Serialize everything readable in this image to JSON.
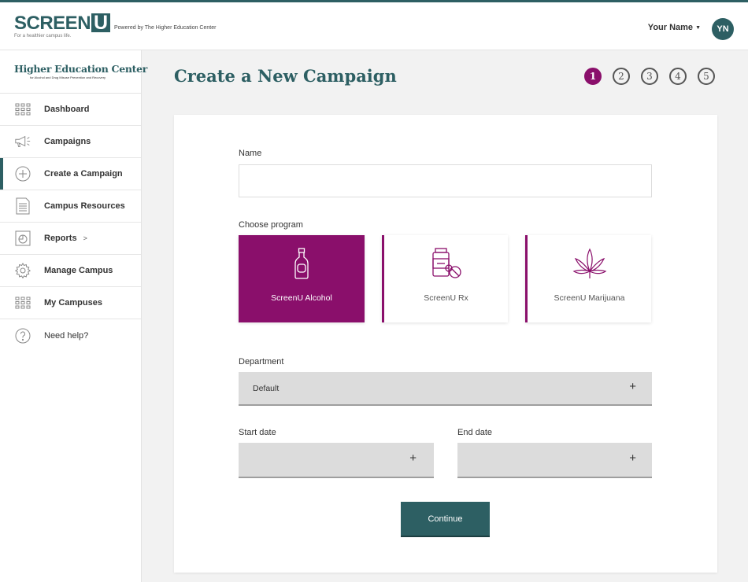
{
  "header": {
    "logo_text": "SCREEN",
    "logo_u": "U",
    "logo_tagline": "For a healthier campus life.",
    "powered_by": "Powered by The Higher Education Center",
    "user_name": "Your Name",
    "user_initials": "YN"
  },
  "sidebar": {
    "org_title": "Higher Education Center",
    "org_subtitle": "for Alcohol and Drug Misuse Prevention and Recovery",
    "items": [
      {
        "label": "Dashboard",
        "icon": "grid-icon"
      },
      {
        "label": "Campaigns",
        "icon": "megaphone-icon"
      },
      {
        "label": "Create a Campaign",
        "icon": "plus-circle-icon",
        "active": true
      },
      {
        "label": "Campus Resources",
        "icon": "document-icon"
      },
      {
        "label": "Reports",
        "icon": "report-icon",
        "chevron": ">"
      },
      {
        "label": "Manage Campus",
        "icon": "gear-icon"
      },
      {
        "label": "My Campuses",
        "icon": "grid-icon"
      },
      {
        "label": "Need help?",
        "icon": "question-icon"
      }
    ]
  },
  "main": {
    "title": "Create a New Campaign",
    "steps": [
      "1",
      "2",
      "3",
      "4",
      "5"
    ],
    "current_step": 1,
    "form": {
      "name_label": "Name",
      "name_value": "",
      "program_label": "Choose program",
      "programs": [
        {
          "label": "ScreenU Alcohol",
          "icon": "bottle-icon",
          "selected": true
        },
        {
          "label": "ScreenU Rx",
          "icon": "pills-icon",
          "selected": false
        },
        {
          "label": "ScreenU Marijuana",
          "icon": "cannabis-leaf-icon",
          "selected": false
        }
      ],
      "department_label": "Department",
      "department_value": "Default",
      "start_date_label": "Start date",
      "end_date_label": "End date",
      "plus_symbol": "+",
      "continue_label": "Continue"
    }
  },
  "colors": {
    "brand_teal": "#2d5f63",
    "accent_purple": "#8a0f6b"
  }
}
